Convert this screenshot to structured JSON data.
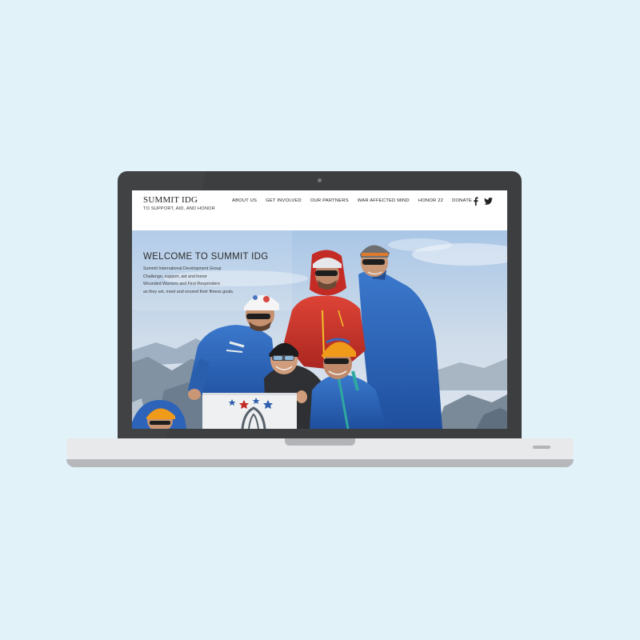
{
  "site": {
    "logo_title": "SUMMIT IDG",
    "tagline": "TO SUPPORT, AID, AND HONOR"
  },
  "nav": {
    "items": [
      {
        "label": "ABOUT US"
      },
      {
        "label": "GET INVOLVED"
      },
      {
        "label": "OUR PARTNERS"
      },
      {
        "label": "WAR AFFECTED MIND"
      },
      {
        "label": "HONOR 22"
      },
      {
        "label": "DONATE"
      }
    ]
  },
  "social": {
    "icons": [
      "facebook-icon",
      "twitter-icon"
    ]
  },
  "hero": {
    "title": "WELCOME TO SUMMIT IDG",
    "lines": [
      "Summit International Development Group",
      "Challenge, support, aid and honor",
      "Wounded Warriors and First Responders",
      "as they set, meet and exceed their fitness goals."
    ]
  },
  "colors": {
    "background": "#e1f2f8",
    "laptop_bezel": "#3d3e40",
    "laptop_base": "#e8e9eb",
    "jacket_blue": "#2d63b8",
    "jacket_red": "#c8322c"
  }
}
